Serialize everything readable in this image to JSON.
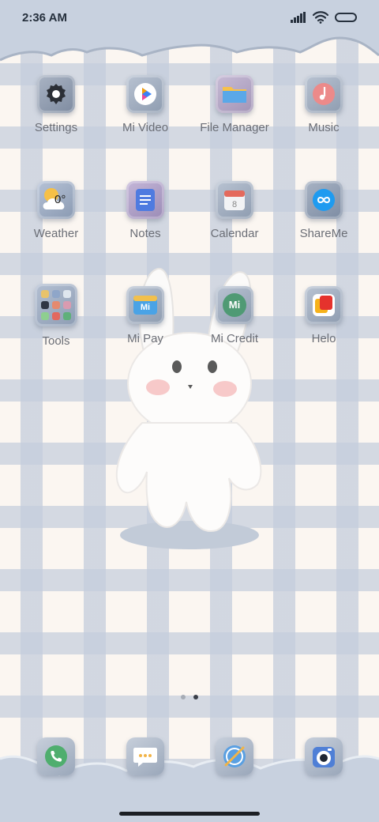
{
  "status_bar": {
    "time": "2:36 AM"
  },
  "apps": [
    {
      "label": "Settings",
      "icon": "gear-icon"
    },
    {
      "label": "Mi Video",
      "icon": "play-icon"
    },
    {
      "label": "File Manager",
      "icon": "folder-icon"
    },
    {
      "label": "Music",
      "icon": "music-note-icon"
    },
    {
      "label": "Weather",
      "icon": "weather-sun-cloud-icon",
      "temp": "0°"
    },
    {
      "label": "Notes",
      "icon": "notes-icon"
    },
    {
      "label": "Calendar",
      "icon": "calendar-icon",
      "day": "8"
    },
    {
      "label": "ShareMe",
      "icon": "infinity-icon"
    },
    {
      "label": "Tools",
      "icon": "folder-grid-icon"
    },
    {
      "label": "Mi Pay",
      "icon": "card-icon",
      "glyph": "Mi"
    },
    {
      "label": "Mi Credit",
      "icon": "credit-icon",
      "glyph": "Mi"
    },
    {
      "label": "Helo",
      "icon": "helo-icon"
    }
  ],
  "dock": [
    {
      "icon": "phone-icon"
    },
    {
      "icon": "messages-icon"
    },
    {
      "icon": "browser-icon"
    },
    {
      "icon": "camera-icon"
    }
  ],
  "pages": {
    "count": 2,
    "active": 2
  },
  "colors": {
    "cloud": "#c8d1df",
    "plaid": "#c4cddc",
    "label": "#6b6e76",
    "dot_active": "#3a3f48",
    "dot_inactive": "#a6acb5"
  }
}
